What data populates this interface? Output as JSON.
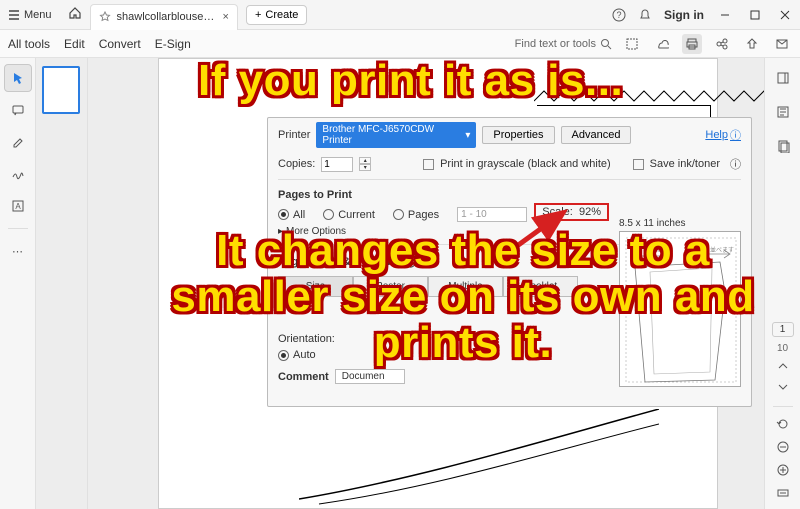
{
  "titlebar": {
    "menu_label": "Menu",
    "tab_label": "shawlcollarblouse-lm.p...",
    "create_label": "Create",
    "signin_label": "Sign in"
  },
  "toolbar": {
    "all_tools": "All tools",
    "edit": "Edit",
    "convert": "Convert",
    "esign": "E-Sign",
    "find_placeholder": "Find text or tools"
  },
  "dialog": {
    "printer_label": "Printer",
    "printer_value": "Brother MFC-J6570CDW Printer",
    "properties_btn": "Properties",
    "advanced_btn": "Advanced",
    "help_label": "Help",
    "copies_label": "Copies:",
    "copies_value": "1",
    "grayscale_label": "Print in grayscale (black and white)",
    "save_ink_label": "Save ink/toner",
    "pages_header": "Pages to Print",
    "all_label": "All",
    "current_label": "Current",
    "pages_label": "Pages",
    "pages_range": "1 - 10",
    "more_options": "More Options",
    "scale_label": "Scale:",
    "scale_value": "92%",
    "preview_label": "8.5 x 11 inches",
    "sizing_header": "Page Sizing & Handling",
    "size_btn": "Size",
    "poster_btn": "Poster",
    "multiple_btn": "Multiple",
    "booklet_btn": "Booklet",
    "orientation_label": "Orientation:",
    "auto_label": "Auto",
    "comments_label": "Comment",
    "comments_value": "Documen"
  },
  "annotation": {
    "line1": "If you print it as is...",
    "line2": "It changes the size to a smaller size on its own and prints it."
  },
  "right_rail": {
    "page_no": "1",
    "page_total": "10"
  }
}
